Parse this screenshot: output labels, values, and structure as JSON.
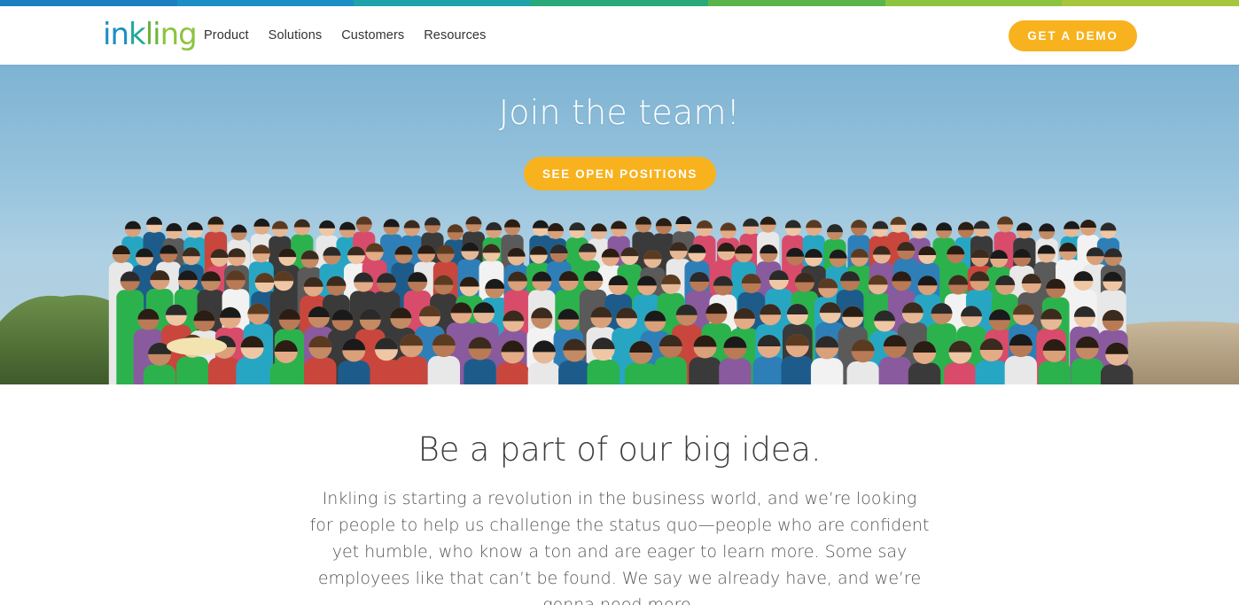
{
  "stripe_colors": [
    "#1d7fc0",
    "#1b8ec5",
    "#1fa3a8",
    "#2aa97a",
    "#5bb44a",
    "#8cc43f",
    "#a6c63d"
  ],
  "colors": {
    "accent": "#f7b21e",
    "text": "#333333",
    "sky": "#8dbcd8"
  },
  "header": {
    "logo_text": "inkling",
    "nav": [
      "Product",
      "Solutions",
      "Customers",
      "Resources"
    ],
    "cta_label": "GET A DEMO"
  },
  "hero": {
    "title": "Join the team!",
    "button_label": "SEE OPEN POSITIONS",
    "image_description": "group-photo"
  },
  "content": {
    "heading": "Be a part of our big idea.",
    "paragraph": "Inkling is starting a revolution in the business world, and we’re looking for people to help us challenge the status quo—people who are confident yet humble, who know a ton and are eager to learn more. Some say employees like that can’t be found. We say we already have, and we’re gonna need more."
  }
}
